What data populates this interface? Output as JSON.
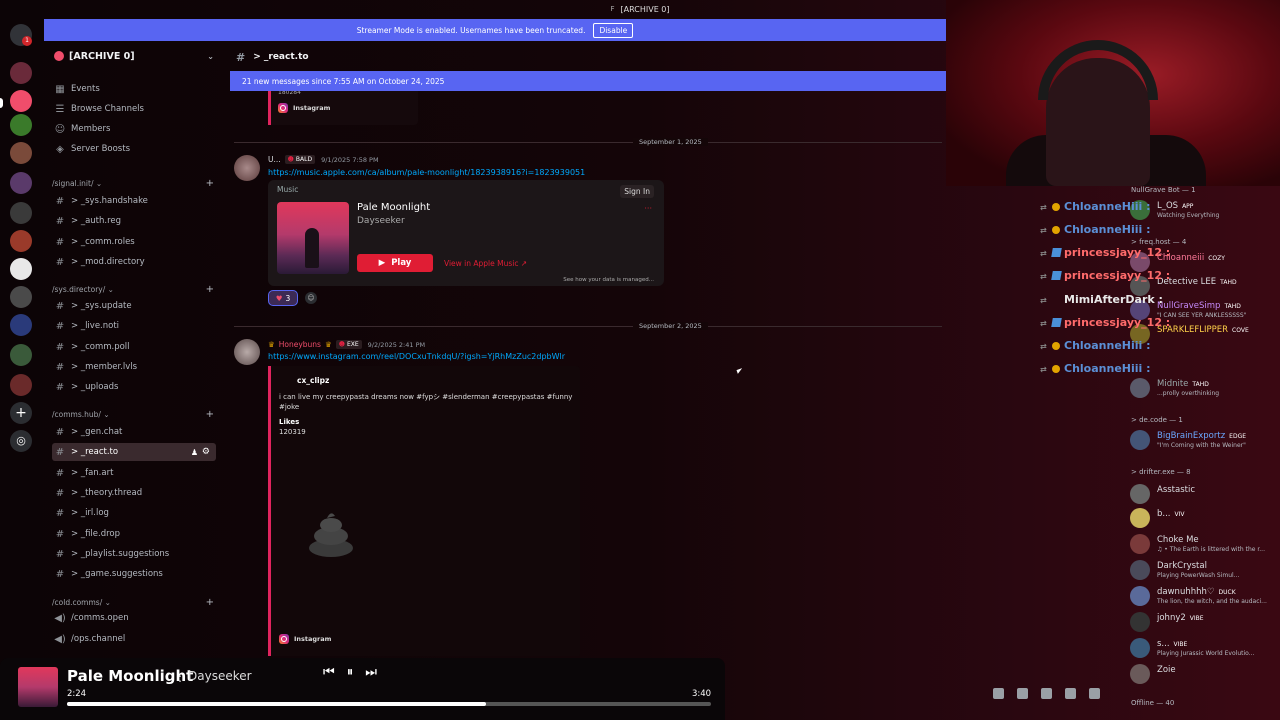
{
  "topbar": {
    "title": "[ARCHIVE 0]",
    "logo": "F"
  },
  "streamer": {
    "text": "Streamer Mode is enabled. Usernames have been truncated.",
    "button": "Disable"
  },
  "guild": {
    "name": "[ARCHIVE 0]"
  },
  "nav": {
    "events": "Events",
    "browse": "Browse Channels",
    "members": "Members",
    "boosts": "Server Boosts"
  },
  "categories": [
    "/signal.init/",
    "/sys.directory/",
    "/comms.hub/",
    "/cold.comms/"
  ],
  "channels": {
    "signal": [
      "> _sys.handshake",
      "> _auth.reg",
      "> _comm.roles",
      "> _mod.directory"
    ],
    "sys": [
      "> _sys.update",
      "> _live.noti",
      "> _comm.poll",
      "> _member.lvls",
      "> _uploads"
    ],
    "comms": [
      "> _gen.chat",
      "> _react.to",
      "> _fan.art",
      "> _theory.thread",
      "> _irl.log",
      "> _file.drop",
      "> _playlist.suggestions",
      "> _game.suggestions"
    ],
    "cold": [
      "/comms.open",
      "/ops.channel"
    ]
  },
  "channel": {
    "name": "> _react.to"
  },
  "newmsgs": "21 new messages since 7:55 AM on October 24, 2025",
  "embed_top": {
    "num": "180284",
    "source": "Instagram"
  },
  "dates": [
    "September 1, 2025",
    "September 2, 2025"
  ],
  "msg1": {
    "author": "U...",
    "tag": "BALD",
    "time": "9/1/2025 7:58 PM",
    "link": "https://music.apple.com/ca/album/pale-moonlight/1823938916?i=1823939051",
    "music_label": "Music",
    "sign_in": "Sign In",
    "track": "Pale Moonlight",
    "artist": "Dayseeker",
    "play": "Play",
    "view": "View in Apple Music ↗",
    "see": "See how your data is managed...",
    "reaction_count": "3"
  },
  "msg2": {
    "author": "Honeybuns",
    "tag": "EXE",
    "time": "9/2/2025 2:41 PM",
    "link": "https://www.instagram.com/reel/DOCxuTnkdqU/?igsh=YjRhMzZuc2dpbWlr",
    "embed_author": "cx_clipz",
    "desc": "i can live my creepypasta dreams now #fypシ #slenderman #creepypastas #funny #joke",
    "likes_label": "Likes",
    "likes": "120319",
    "source": "Instagram"
  },
  "player": {
    "title": "Pale Moonlight",
    "sep": ":",
    "artist": "Dayseeker",
    "elapsed": "2:24",
    "total": "3:40",
    "progress": 0.65
  },
  "chat": [
    {
      "name": "ChloanneHiii :",
      "color": "#5b8fd6",
      "badge": "b1"
    },
    {
      "name": "ChloanneHiii :",
      "color": "#5b8fd6",
      "badge": "b1"
    },
    {
      "name": "princessjayy_12 :",
      "color": "#ff6b6b",
      "badge": "b0"
    },
    {
      "name": "princessjayy_12 :",
      "color": "#ff6b6b",
      "badge": "b0"
    },
    {
      "name": "MimiAfterDark :",
      "color": "#e8e8e8",
      "badge": "sw"
    },
    {
      "name": "princessjayy_12 :",
      "color": "#ff6b6b",
      "badge": "b0"
    },
    {
      "name": "ChloanneHiii :",
      "color": "#5b8fd6",
      "badge": "b1"
    },
    {
      "name": "ChloanneHiii :",
      "color": "#5b8fd6",
      "badge": "b1"
    }
  ],
  "member_cats": [
    "NullGrave Bot — 1",
    "> freq.host — 4",
    "> de.code — 1",
    "> drifter.exe — 8",
    "Offline — 40"
  ],
  "member_list": [
    {
      "name": "L_OS",
      "tag": "APP",
      "status": "Watching Everything",
      "color": "#dbdee1",
      "av": "#3a6e3a"
    },
    {
      "name": "Chloanneiii",
      "tag": "COZY",
      "status": "",
      "color": "#ff7a9a",
      "av": "#7a4a6a"
    },
    {
      "name": "Detective LEE",
      "tag": "TAHD",
      "status": "",
      "color": "#dbdee1",
      "av": "#555"
    },
    {
      "name": "NullGraveSimp",
      "tag": "TAHD",
      "status": "\"I CAN SEE YER ANKLESSSSS\"",
      "color": "#c58af9",
      "av": "#554477"
    },
    {
      "name": "SPARKLEFLIPPER",
      "tag": "COVE",
      "status": "",
      "color": "#ffd24a",
      "av": "#776622"
    },
    {
      "name": "Midnite",
      "tag": "TAHD",
      "status": "...prolly overthinking",
      "color": "#9aa",
      "av": "#5a5a6a"
    },
    {
      "name": "BigBrainExportz",
      "tag": "EDGE",
      "status": "\"I'm Coming with the Weiner\"",
      "color": "#6aa7ff",
      "av": "#445577"
    },
    {
      "name": "Asstastic",
      "tag": "",
      "status": "",
      "color": "#dbdee1",
      "av": "#666"
    },
    {
      "name": "b...",
      "tag": "VIV",
      "status": "",
      "color": "#dbdee1",
      "av": "#c9b45a"
    },
    {
      "name": "Choke Me",
      "tag": "",
      "status": "♫ • The Earth is littered with the r...",
      "color": "#dbdee1",
      "av": "#7a3a3a"
    },
    {
      "name": "DarkCrystal",
      "tag": "",
      "status": "Playing PowerWash Simul...",
      "color": "#dbdee1",
      "av": "#4a4a5a"
    },
    {
      "name": "dawnuhhhh♡",
      "tag": "DUCK",
      "status": "The lion, the witch, and the audaci...",
      "color": "#dbdee1",
      "av": "#5a6a9a"
    },
    {
      "name": "johny2",
      "tag": "VIBE",
      "status": "",
      "color": "#dbdee1",
      "av": "#333"
    },
    {
      "name": "s...",
      "tag": "VIBE",
      "status": "Playing Jurassic World Evolutio...",
      "color": "#dbdee1",
      "av": "#3a5a7a"
    },
    {
      "name": "Zoie",
      "tag": "",
      "status": "",
      "color": "#dbdee1",
      "av": "#6a5a5a"
    }
  ]
}
